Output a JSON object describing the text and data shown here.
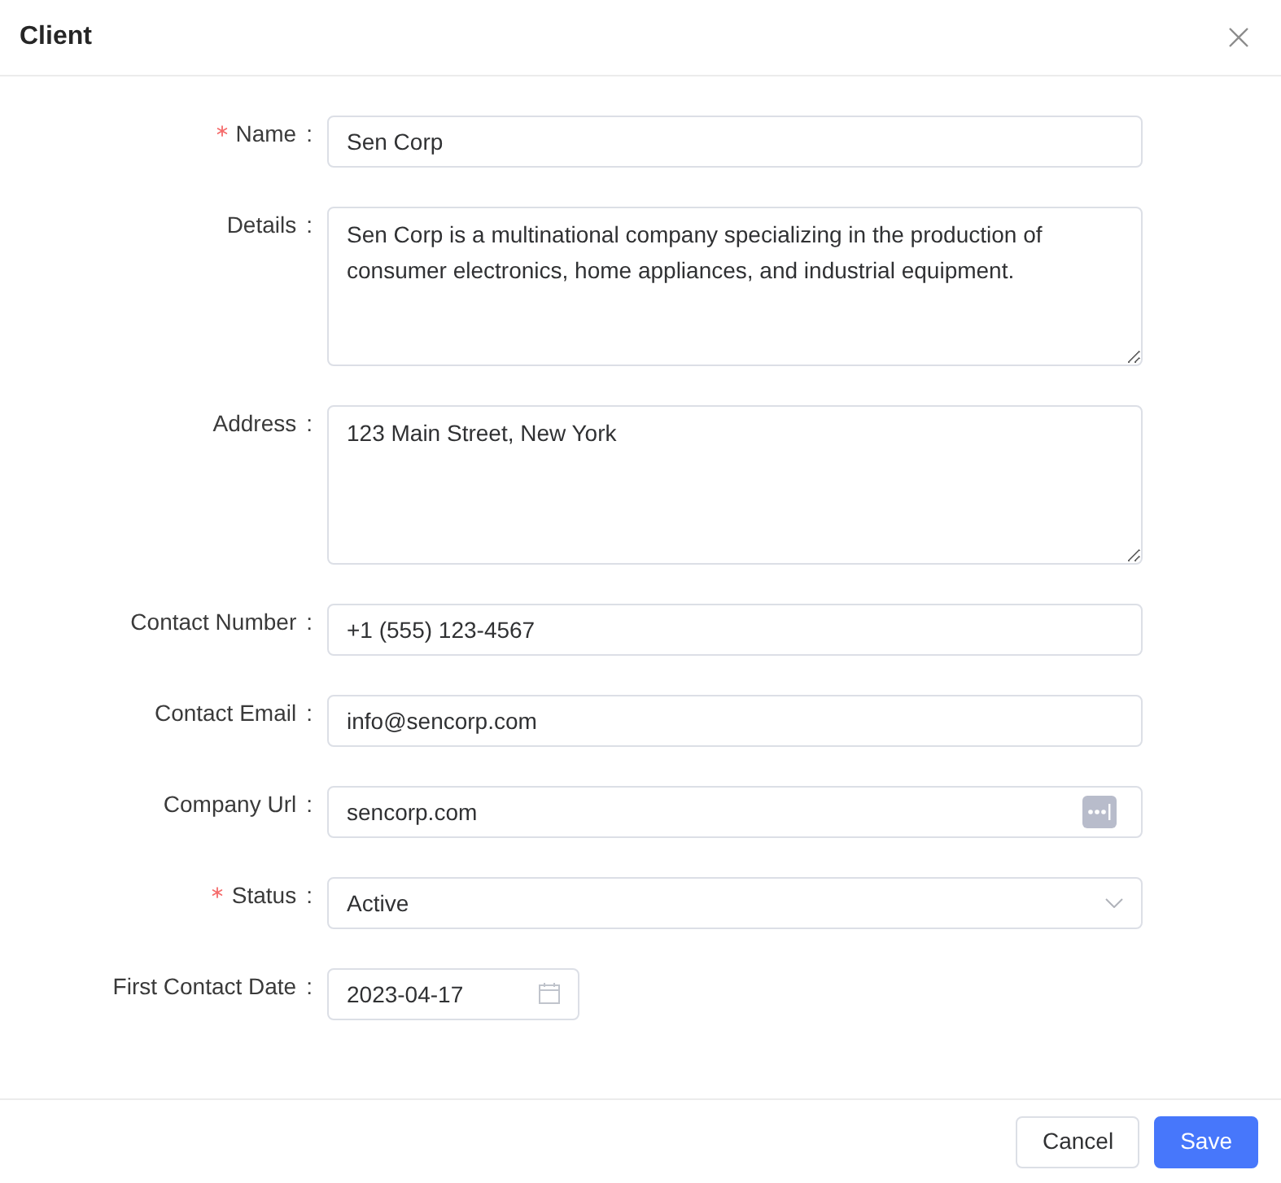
{
  "window": {
    "title": "Client"
  },
  "fields": [
    {
      "kind": "text",
      "label": "Name",
      "colon": ":",
      "required": true,
      "value": "Sen Corp"
    },
    {
      "kind": "textarea",
      "label": "Details",
      "colon": ":",
      "required": false,
      "value": "Sen Corp is a multinational company specializing in the production of consumer electronics, home appliances, and industrial equipment."
    },
    {
      "kind": "textarea",
      "label": "Address",
      "colon": ":",
      "required": false,
      "value": "123 Main Street, New York"
    },
    {
      "kind": "text",
      "label": "Contact Number",
      "colon": ":",
      "required": false,
      "value": "+1 (555) 123-4567"
    },
    {
      "kind": "text",
      "label": "Contact Email",
      "colon": ":",
      "required": false,
      "value": "info@sencorp.com"
    },
    {
      "kind": "url",
      "label": "Company Url",
      "colon": ":",
      "required": false,
      "value": "sencorp.com"
    },
    {
      "kind": "select",
      "label": "Status",
      "colon": ":",
      "required": true,
      "value": "Active"
    },
    {
      "kind": "date",
      "label": "First Contact Date",
      "colon": ":",
      "required": false,
      "value": "2023-04-17"
    }
  ],
  "buttons": [
    {
      "kind": "default",
      "label": "Cancel"
    },
    {
      "kind": "primary",
      "label": "Save"
    }
  ]
}
